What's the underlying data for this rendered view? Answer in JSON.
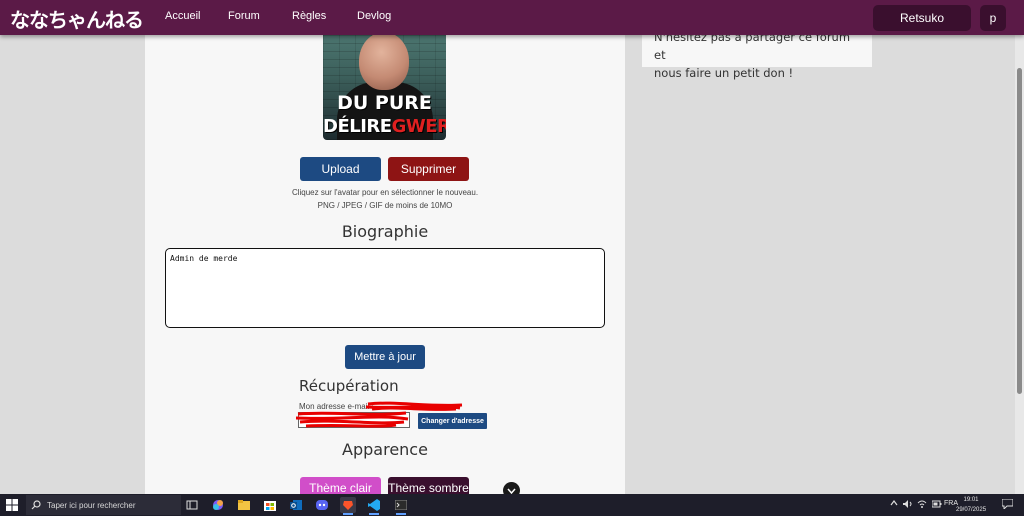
{
  "header": {
    "logo": "ななちゃんねる",
    "nav": [
      "Accueil",
      "Forum",
      "Règles",
      "Devlog"
    ],
    "user_button": "Retsuko",
    "profile_button": "p"
  },
  "profile": {
    "avatar_text_line1": "DU PURE",
    "avatar_text_line2_white": "DÉLIRE",
    "avatar_text_line2_red": "GWER",
    "upload_label": "Upload",
    "delete_label": "Supprimer",
    "avatar_hint": "Cliquez sur l'avatar pour en sélectionner le nouveau.",
    "format_hint": "PNG / JPEG / GIF de moins de 10MO",
    "bio_title": "Biographie",
    "bio_value": "Admin de merde",
    "update_label": "Mettre à jour",
    "recovery_title": "Récupération",
    "email_label": "Mon adresse e-mail :",
    "change_email_label": "Changer d'adresse",
    "appearance_title": "Apparence",
    "light_theme_label": "Thème clair",
    "dark_theme_label": "Thème sombre"
  },
  "sidebar": {
    "line1": "N'hésitez pas à partager ce forum et",
    "line2": "nous faire un petit don !"
  },
  "taskbar": {
    "search_placeholder": "Taper ici pour rechercher",
    "language": "FRA",
    "time": "19:01",
    "date": "29/07/2025"
  },
  "colors": {
    "header_bg": "#5b1a47",
    "primary_button": "#1d4a82",
    "danger_button": "#8e1414",
    "light_theme_button": "#d14ec9",
    "dark_theme_button": "#3a0f2e"
  }
}
